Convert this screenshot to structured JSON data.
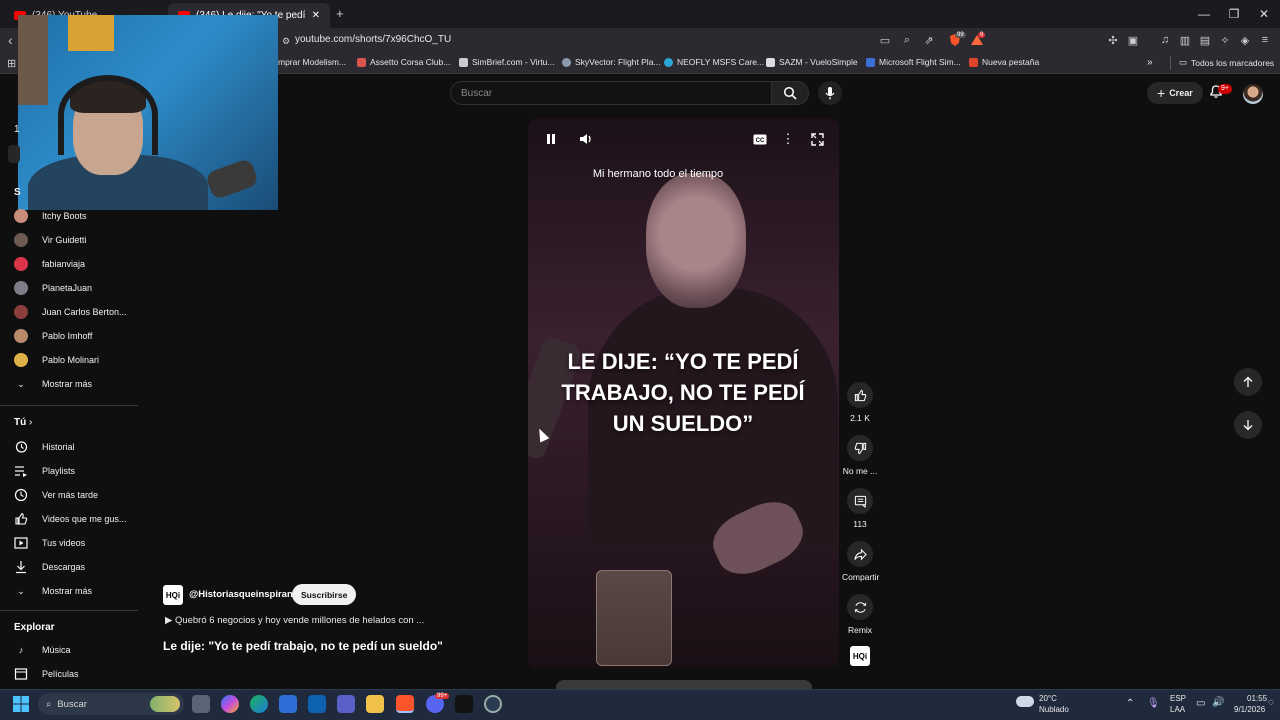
{
  "browser": {
    "tabs": [
      {
        "label": "(346) YouTube",
        "active": false
      },
      {
        "label": "(346) Le dije: \"Yo te pedí trab",
        "active": true
      }
    ],
    "new_tab": "+",
    "url": "youtube.com/shorts/7x96ChcO_TU",
    "bookmarks": [
      {
        "label": "mprar Modelism...",
        "color": "#b64b2b"
      },
      {
        "label": "Assetto Corsa Club...",
        "color": "#d9534f"
      },
      {
        "label": "SimBrief.com - Virtu...",
        "color": "#cccccc"
      },
      {
        "label": "SkyVector: Flight Pla...",
        "color": "#8a9bb0"
      },
      {
        "label": "NEOFLY MSFS Care...",
        "color": "#2aa6d8"
      },
      {
        "label": "SAZM - VueloSimple",
        "color": "#dddddd"
      },
      {
        "label": "Microsoft Flight Sim...",
        "color": "#3a6fd8"
      },
      {
        "label": "Nueva pestaña",
        "color": "#e0442a"
      }
    ],
    "bookmarks_overflow": "»",
    "all_bookmarks": "Todos los marcadores",
    "extension_badges": {
      "brave": "99",
      "rewards": "9"
    }
  },
  "youtube": {
    "search_placeholder": "Buscar",
    "create_label": "Crear",
    "notifications_badge": "9+"
  },
  "sidebar": {
    "subscriptions": [
      {
        "label": "Itchy Boots",
        "color": "#c98c7a"
      },
      {
        "label": "Vir Guidetti",
        "color": "#6c5a52"
      },
      {
        "label": "fabianviaja",
        "color": "#d8344a"
      },
      {
        "label": "PlanetaJuan",
        "color": "#7d7d8a"
      },
      {
        "label": "Juan Carlos Berton...",
        "color": "#8e3d3d"
      },
      {
        "label": "Pablo Imhoff",
        "color": "#b98a6a"
      },
      {
        "label": "Pablo Molinari",
        "color": "#e0b14a"
      }
    ],
    "show_more": "Mostrar más",
    "you_heading": "Tú",
    "you_items": [
      {
        "label": "Historial",
        "icon": "history-icon"
      },
      {
        "label": "Playlists",
        "icon": "playlists-icon"
      },
      {
        "label": "Ver más tarde",
        "icon": "watch-later-icon"
      },
      {
        "label": "Videos que me gus...",
        "icon": "liked-videos-icon"
      },
      {
        "label": "Tus videos",
        "icon": "your-videos-icon"
      },
      {
        "label": "Descargas",
        "icon": "downloads-icon"
      }
    ],
    "show_more_2": "Mostrar más",
    "explore_heading": "Explorar",
    "explore_items": [
      {
        "label": "Música",
        "icon": "music-icon"
      },
      {
        "label": "Películas",
        "icon": "movies-icon"
      }
    ],
    "partial_s": "S",
    "partial_1": "1"
  },
  "short": {
    "caption": "Mi hermano todo el tiempo",
    "overlay_text": "LE DIJE: “YO TE PEDÍ TRABAJO, NO TE PEDÍ UN SUELDO”",
    "likes": "2.1 K",
    "dislike_label": "No me ...",
    "comments": "113",
    "share_label": "Compartir",
    "remix_label": "Remix",
    "channel_logo_text": "HQi",
    "channel_name": "@Historiasqueinspiran",
    "subscribe_label": "Suscribirse",
    "related": "▶ Quebró 6 negocios y hoy vende millones de helados con ...",
    "title": "Le dije: \"Yo te pedí trabajo, no te pedí un sueldo\""
  },
  "taskbar": {
    "search_label": "Buscar",
    "weather_temp": "20°C",
    "weather_desc": "Nublado",
    "lang_1": "ESP",
    "lang_2": "LAA",
    "time": "01:55",
    "date": "9/1/2026",
    "discord_badge": "99+"
  }
}
